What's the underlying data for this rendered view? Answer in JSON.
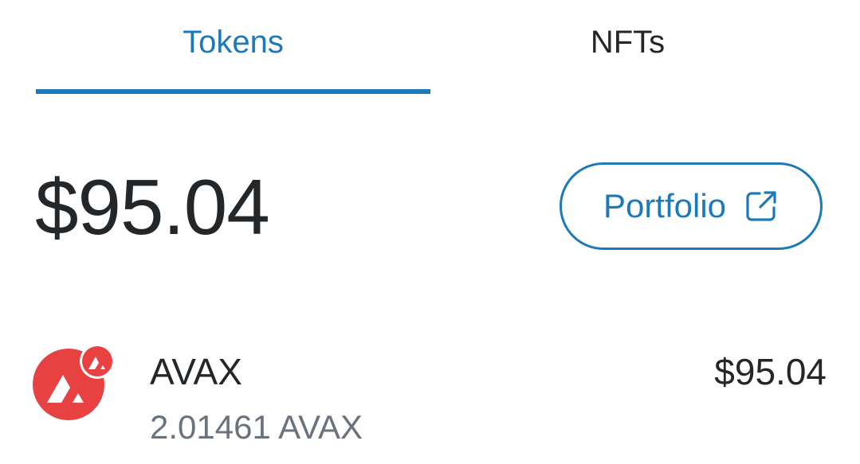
{
  "tabs": [
    {
      "label": "Tokens",
      "active": true
    },
    {
      "label": "NFTs",
      "active": false
    }
  ],
  "balance": {
    "total": "$95.04"
  },
  "portfolio_button": {
    "label": "Portfolio",
    "icon": "external-link-icon"
  },
  "tokens": [
    {
      "name": "AVAX",
      "amount": "2.01461 AVAX",
      "value": "$95.04",
      "icon": "avalanche-logo-icon",
      "badge_icon": "avalanche-network-badge-icon"
    }
  ],
  "colors": {
    "accent": "#1c7ab8",
    "text_primary": "#24272a",
    "text_secondary": "#6a737d",
    "avax_red": "#e84142"
  }
}
